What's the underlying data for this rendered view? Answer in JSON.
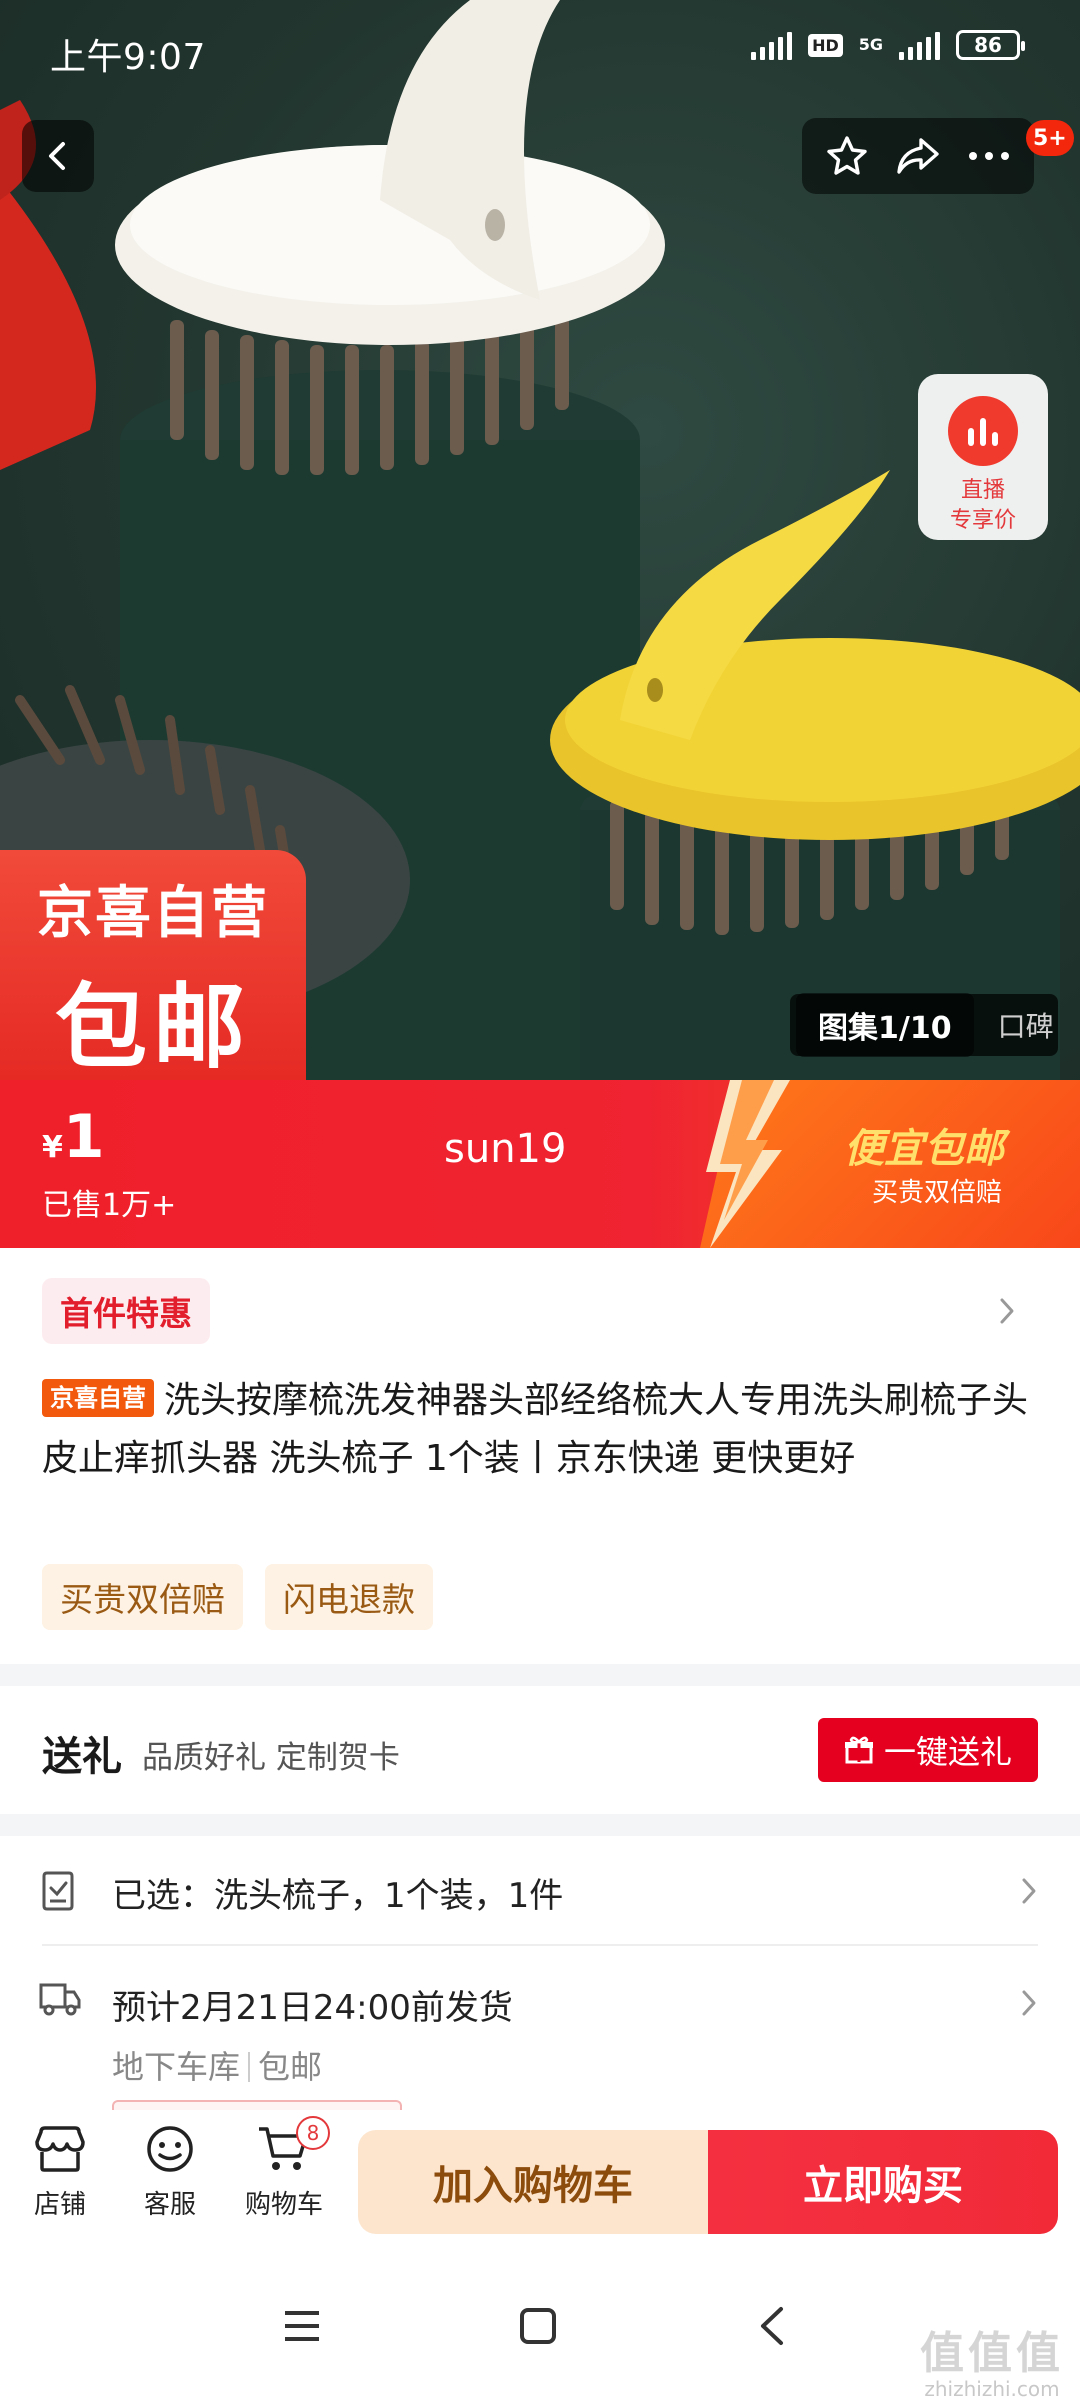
{
  "status_bar": {
    "time": "上午9:07",
    "hd": "HD",
    "network": "5G",
    "battery": "86"
  },
  "hero": {
    "message_badge": "5+",
    "live_card": {
      "line1": "直播",
      "line2": "专享价"
    },
    "promo_tag": {
      "line1": "京喜自营",
      "line2": "包邮"
    },
    "gallery": {
      "active_label": "图集1/10",
      "other_label": "口碑"
    }
  },
  "price_bar": {
    "currency": "¥",
    "price": "1",
    "sold": "已售1万+",
    "live_name": "sun19",
    "promo_title": "便宜包邮",
    "promo_sub": "买贵双倍赔"
  },
  "product": {
    "coupon": "首件特惠",
    "self_tag": "京喜自营",
    "title": "洗头按摩梳洗发神器头部经络梳大人专用洗头刷梳子头皮止痒抓头器 洗头梳子 1个装丨京东快递 更快更好",
    "badges": [
      "买贵双倍赔",
      "闪电退款"
    ]
  },
  "gift": {
    "title": "送礼",
    "subtitle": "品质好礼 定制贺卡",
    "button": "一键送礼"
  },
  "selection": {
    "text": "已选：洗头梳子，1个装，1件"
  },
  "shipping": {
    "text": "预计2月21日24:00前发货",
    "location": "地下车库",
    "free_shipping": "包邮"
  },
  "bottom_bar": {
    "shop": "店铺",
    "service": "客服",
    "cart": "购物车",
    "cart_count": "8",
    "add_to_cart": "加入购物车",
    "buy_now": "立即购买"
  },
  "watermark": {
    "main": "值值值",
    "sub": "zhizhizhi.com"
  },
  "colors": {
    "brand_red": "#e4001e",
    "price_red": "#f0202a",
    "promo_orange": "#f8471a",
    "badge_text": "#9a5a14"
  },
  "icons": [
    "back-icon",
    "star-icon",
    "share-icon",
    "more-icon",
    "live-icon",
    "gift-icon",
    "selected-icon",
    "truck-icon",
    "shop-icon",
    "service-icon",
    "cart-icon",
    "menu-icon",
    "home-icon",
    "nav-back-icon"
  ]
}
